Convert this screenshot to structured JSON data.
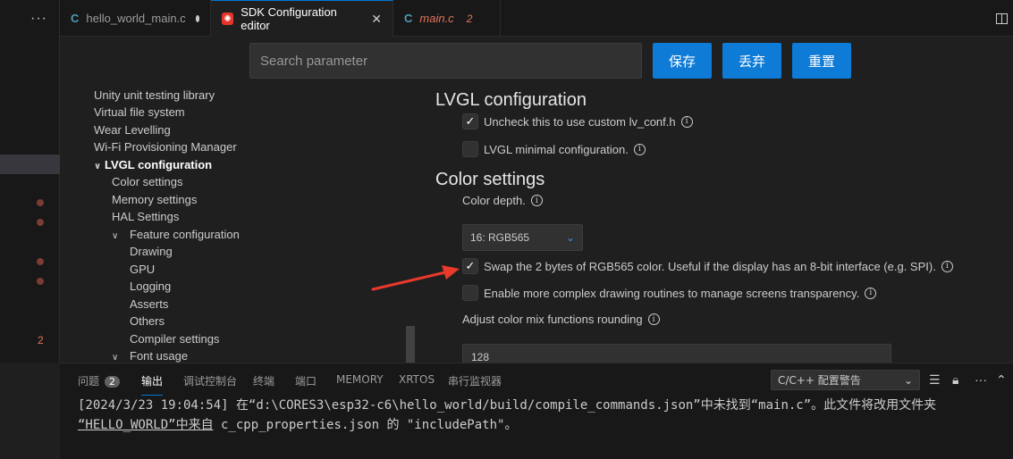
{
  "activity_bar": {
    "more_label": "···",
    "error_count": "2"
  },
  "tabs": [
    {
      "lang": "C",
      "label": "hello_world_main.c",
      "state": "modified"
    },
    {
      "icon": "esp-idf-icon",
      "label": "SDK Configuration editor",
      "close": "✕",
      "state": "active"
    },
    {
      "lang": "C",
      "label": "main.c",
      "errors": "2",
      "state": "error"
    }
  ],
  "header": {
    "search_placeholder": "Search parameter",
    "save_label": "保存",
    "discard_label": "丢弃",
    "reset_label": "重置"
  },
  "nav": {
    "items": [
      {
        "label": "Unity unit testing library"
      },
      {
        "label": "Virtual file system"
      },
      {
        "label": "Wear Levelling"
      },
      {
        "label": "Wi-Fi Provisioning Manager"
      },
      {
        "label": "LVGL configuration",
        "expanded": true
      },
      {
        "label": "Color settings"
      },
      {
        "label": "Memory settings"
      },
      {
        "label": "HAL Settings"
      },
      {
        "label": "Feature configuration",
        "expanded": true
      },
      {
        "label": "Drawing"
      },
      {
        "label": "GPU"
      },
      {
        "label": "Logging"
      },
      {
        "label": "Asserts"
      },
      {
        "label": "Others"
      },
      {
        "label": "Compiler settings"
      },
      {
        "label": "Font usage",
        "expanded": true
      }
    ]
  },
  "panel": {
    "lvgl_heading": "LVGL configuration",
    "opt_custom_conf": {
      "label": "Uncheck this to use custom lv_conf.h",
      "checked": true
    },
    "opt_minimal": {
      "label": "LVGL minimal configuration.",
      "checked": false
    },
    "color_heading": "Color settings",
    "color_depth_label": "Color depth.",
    "color_depth_value": "16: RGB565",
    "opt_swap": {
      "label": "Swap the 2 bytes of RGB565 color. Useful if the display has an 8-bit interface (e.g. SPI).",
      "checked": true
    },
    "opt_complex": {
      "label": "Enable more complex drawing routines to manage screens transparency.",
      "checked": false
    },
    "mix_rounding_label": "Adjust color mix functions rounding",
    "mix_rounding_value": "128"
  },
  "bottom_panel": {
    "tabs": [
      {
        "label": "问题",
        "badge": "2"
      },
      {
        "label": "输出",
        "active": true
      },
      {
        "label": "调试控制台"
      },
      {
        "label": "终端"
      },
      {
        "label": "端口"
      },
      {
        "label": "MEMORY"
      },
      {
        "label": "XRTOS"
      },
      {
        "label": "串行监视器"
      }
    ],
    "output_channel": "C/C++ 配置警告",
    "output_line1": "[2024/3/23 19:04:54] 在“d:\\CORES3\\esp32-c6\\hello_world/build/compile_commands.json”中未找到“main.c”。此文件将改用文件夹",
    "output_line2_a": "“HELLO_WORLD”中来自",
    "output_line2_b": " c_cpp_properties.json 的 \"includePath\"。"
  },
  "colors": {
    "accent": "#0e7bd6",
    "error": "#e2745a",
    "arrow": "#e8392b"
  }
}
